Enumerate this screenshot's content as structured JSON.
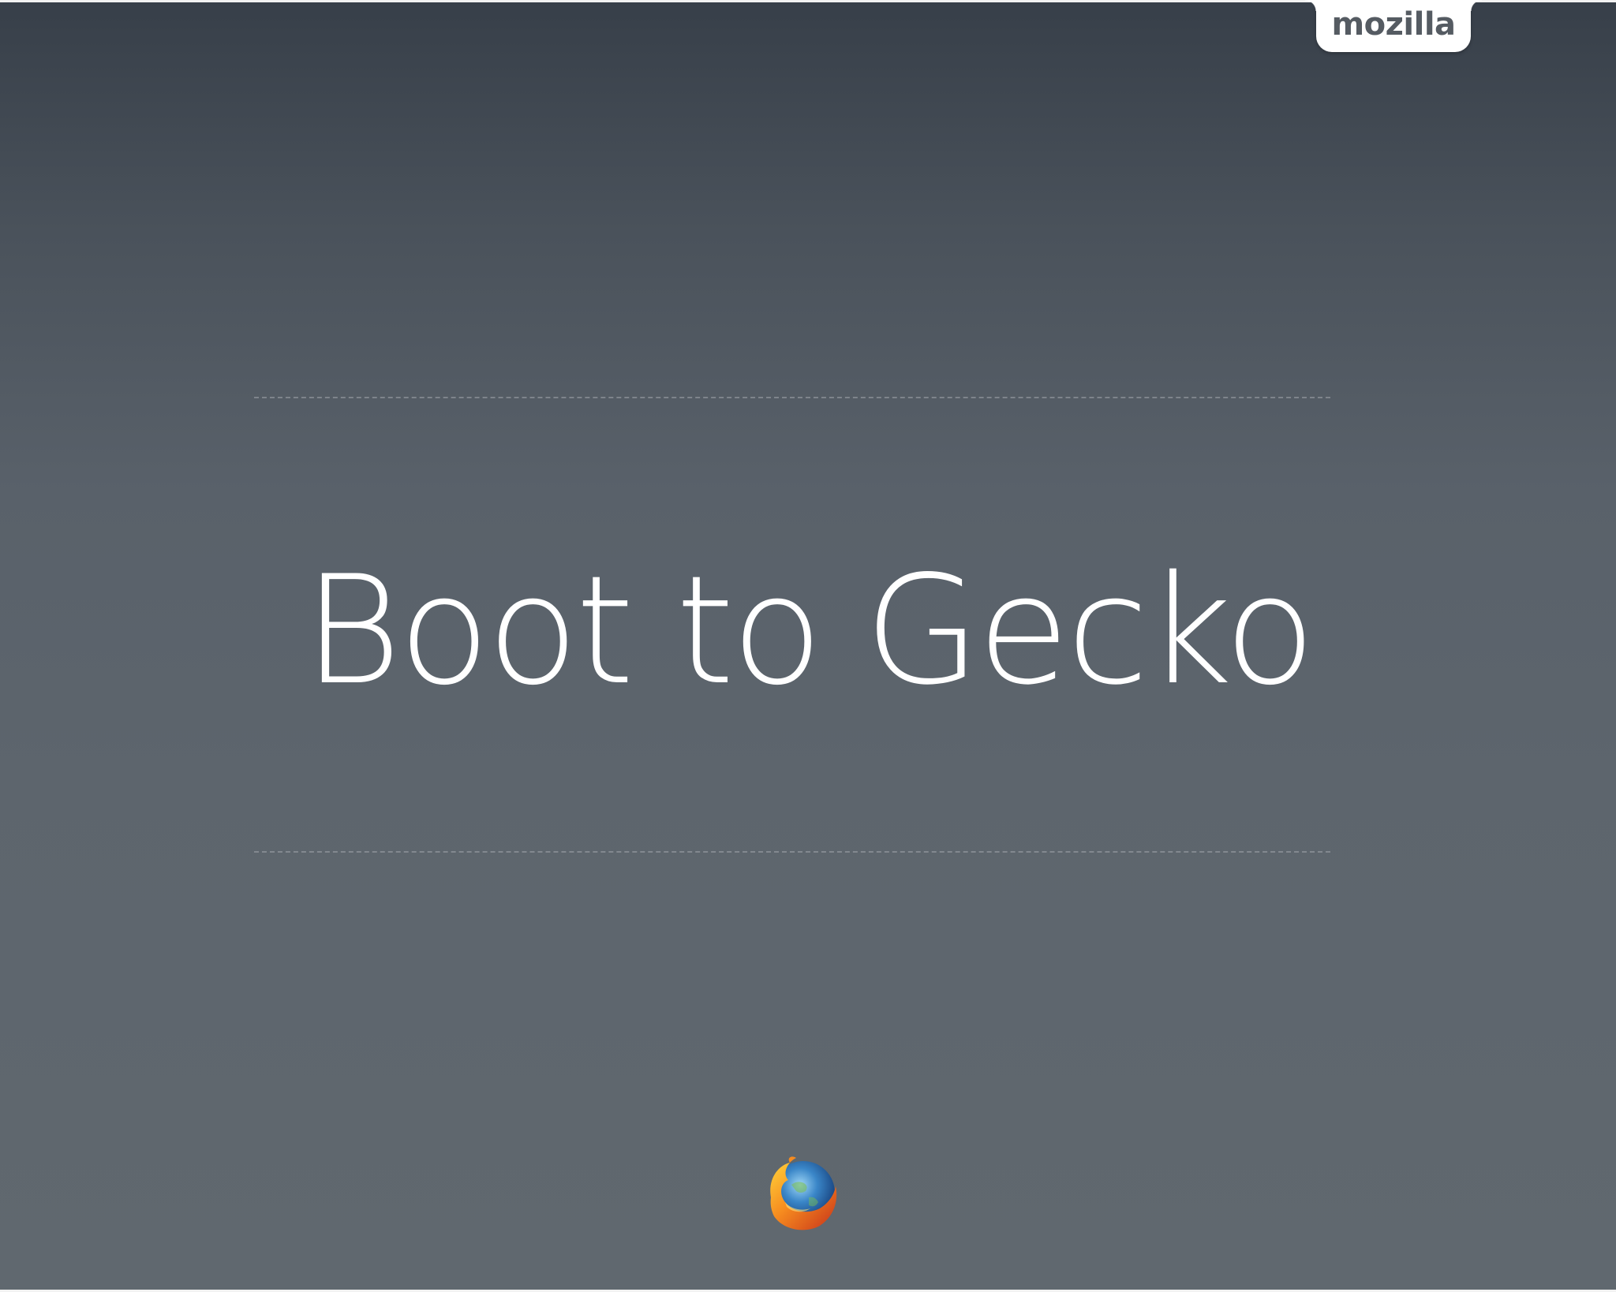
{
  "slide": {
    "title": "Boot to Gecko"
  },
  "branding": {
    "wordmark": "mozilla",
    "logo_icon": "firefox-logo-icon"
  },
  "colors": {
    "background_top": "#373f49",
    "background_bottom": "#60686f",
    "title_text": "#ffffff",
    "wordmark_text": "#555b62",
    "tab_background": "#ffffff"
  }
}
